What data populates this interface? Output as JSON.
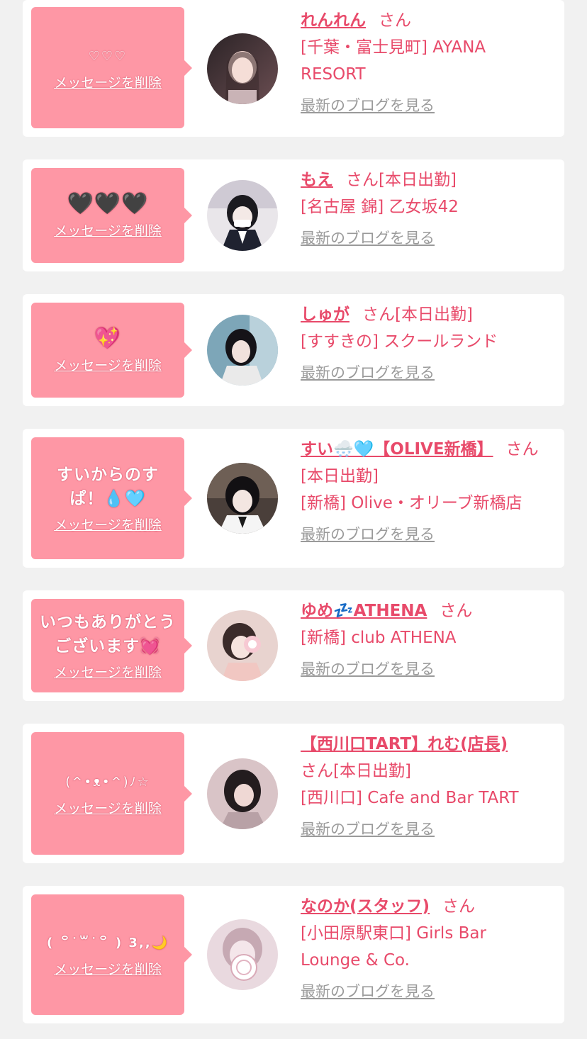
{
  "delete_label": "メッセージを削除",
  "blog_label": "最新のブログを見る",
  "cards": [
    {
      "message": "♡♡♡",
      "name": "れんれん",
      "san": "さん",
      "status": "",
      "shop": "[千葉・富士見町] AYANA RESORT"
    },
    {
      "message": "🖤🖤🖤",
      "name": "もえ",
      "san": "さん",
      "status": "[本日出勤]",
      "shop": "[名古屋 錦] 乙女坂42"
    },
    {
      "message": "💖",
      "name": "しゅが",
      "san": "さん",
      "status": "[本日出勤]",
      "shop": "[すすきの] スクールランド"
    },
    {
      "message": "すいからのすぱ！💧🩵",
      "name": "すい🌨️🩵【OLIVE新橋】",
      "san": "さん",
      "status": "[本日出勤]",
      "shop": "[新橋] Olive・オリーブ新橋店"
    },
    {
      "message": "いつもありがとうございます💓",
      "name": "ゆめ💤ATHENA",
      "san": "さん",
      "status": "",
      "shop": "[新橋] club ATHENA"
    },
    {
      "message": "(^•ᴥ•^)ﾉ☆",
      "name": "【西川口TART】れむ(店長)",
      "san": "さん",
      "status": "[本日出勤]",
      "shop": "[西川口] Cafe and Bar TART"
    },
    {
      "message": "( ꒪˙꒳˙꒪ ) 3,,🌙",
      "name": "なのか(スタッフ)",
      "san": "さん",
      "status": "",
      "shop": "[小田原駅東口] Girls Bar Lounge & Co."
    }
  ],
  "colors": {
    "accent": "#e84a6a",
    "bubble": "#fe97a5",
    "background": "#f1f1f1",
    "link_gray": "#9a9a9a"
  }
}
